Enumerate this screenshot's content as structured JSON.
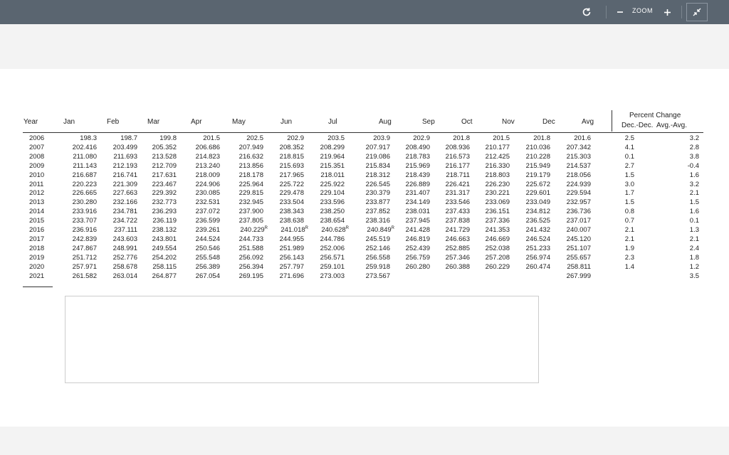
{
  "toolbar": {
    "zoom_label": "ZOOM",
    "icons": [
      "refresh-icon",
      "zoom-out-icon",
      "zoom-in-icon",
      "collapse-icon"
    ]
  },
  "table": {
    "headers": [
      "Year",
      "Jan",
      "Feb",
      "Mar",
      "Apr",
      "May",
      "Jun",
      "Jul",
      "Aug",
      "Sep",
      "Oct",
      "Nov",
      "Dec",
      "Avg"
    ],
    "pct_header": "Percent Change",
    "pct_sub1": "Dec.-Dec.",
    "pct_sub2": "Avg.-Avg.",
    "rows": [
      [
        "2006",
        "198.3",
        "198.7",
        "199.8",
        "201.5",
        "202.5",
        "202.9",
        "203.5",
        "203.9",
        "202.9",
        "201.8",
        "201.5",
        "201.8",
        "201.6",
        "2.5",
        "3.2"
      ],
      [
        "2007",
        "202.416",
        "203.499",
        "205.352",
        "206.686",
        "207.949",
        "208.352",
        "208.299",
        "207.917",
        "208.490",
        "208.936",
        "210.177",
        "210.036",
        "207.342",
        "4.1",
        "2.8"
      ],
      [
        "2008",
        "211.080",
        "211.693",
        "213.528",
        "214.823",
        "216.632",
        "218.815",
        "219.964",
        "219.086",
        "218.783",
        "216.573",
        "212.425",
        "210.228",
        "215.303",
        "0.1",
        "3.8"
      ],
      [
        "2009",
        "211.143",
        "212.193",
        "212.709",
        "213.240",
        "213.856",
        "215.693",
        "215.351",
        "215.834",
        "215.969",
        "216.177",
        "216.330",
        "215.949",
        "214.537",
        "2.7",
        "-0.4"
      ],
      [
        "2010",
        "216.687",
        "216.741",
        "217.631",
        "218.009",
        "218.178",
        "217.965",
        "218.011",
        "218.312",
        "218.439",
        "218.711",
        "218.803",
        "219.179",
        "218.056",
        "1.5",
        "1.6"
      ],
      [
        "2011",
        "220.223",
        "221.309",
        "223.467",
        "224.906",
        "225.964",
        "225.722",
        "225.922",
        "226.545",
        "226.889",
        "226.421",
        "226.230",
        "225.672",
        "224.939",
        "3.0",
        "3.2"
      ],
      [
        "2012",
        "226.665",
        "227.663",
        "229.392",
        "230.085",
        "229.815",
        "229.478",
        "229.104",
        "230.379",
        "231.407",
        "231.317",
        "230.221",
        "229.601",
        "229.594",
        "1.7",
        "2.1"
      ],
      [
        "2013",
        "230.280",
        "232.166",
        "232.773",
        "232.531",
        "232.945",
        "233.504",
        "233.596",
        "233.877",
        "234.149",
        "233.546",
        "233.069",
        "233.049",
        "232.957",
        "1.5",
        "1.5"
      ],
      [
        "2014",
        "233.916",
        "234.781",
        "236.293",
        "237.072",
        "237.900",
        "238.343",
        "238.250",
        "237.852",
        "238.031",
        "237.433",
        "236.151",
        "234.812",
        "236.736",
        "0.8",
        "1.6"
      ],
      [
        "2015",
        "233.707",
        "234.722",
        "236.119",
        "236.599",
        "237.805",
        "238.638",
        "238.654",
        "238.316",
        "237.945",
        "237.838",
        "237.336",
        "236.525",
        "237.017",
        "0.7",
        "0.1"
      ],
      [
        "2016",
        "236.916",
        "237.111",
        "238.132",
        "239.261",
        "240.229",
        "241.018",
        "240.628",
        "240.849",
        "241.428",
        "241.729",
        "241.353",
        "241.432",
        "240.007",
        "2.1",
        "1.3"
      ],
      [
        "2017",
        "242.839",
        "243.603",
        "243.801",
        "244.524",
        "244.733",
        "244.955",
        "244.786",
        "245.519",
        "246.819",
        "246.663",
        "246.669",
        "246.524",
        "245.120",
        "2.1",
        "2.1"
      ],
      [
        "2018",
        "247.867",
        "248.991",
        "249.554",
        "250.546",
        "251.588",
        "251.989",
        "252.006",
        "252.146",
        "252.439",
        "252.885",
        "252.038",
        "251.233",
        "251.107",
        "1.9",
        "2.4"
      ],
      [
        "2019",
        "251.712",
        "252.776",
        "254.202",
        "255.548",
        "256.092",
        "256.143",
        "256.571",
        "256.558",
        "256.759",
        "257.346",
        "257.208",
        "256.974",
        "255.657",
        "2.3",
        "1.8"
      ],
      [
        "2020",
        "257.971",
        "258.678",
        "258.115",
        "256.389",
        "256.394",
        "257.797",
        "259.101",
        "259.918",
        "260.280",
        "260.388",
        "260.229",
        "260.474",
        "258.811",
        "1.4",
        "1.2"
      ],
      [
        "2021",
        "261.582",
        "263.014",
        "264.877",
        "267.054",
        "269.195",
        "271.696",
        "273.003",
        "273.567",
        "",
        "",
        "",
        "",
        "267.999",
        "",
        "3.5"
      ]
    ],
    "revised_mark": "R",
    "revised_cells": [
      [
        10,
        5
      ],
      [
        10,
        6
      ],
      [
        10,
        7
      ],
      [
        10,
        8
      ]
    ]
  }
}
